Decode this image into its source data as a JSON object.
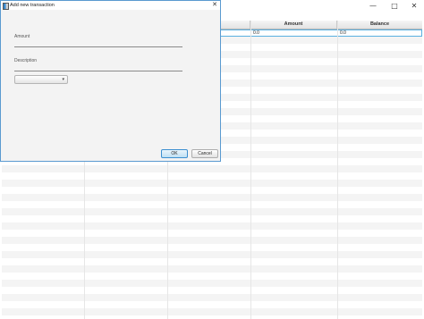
{
  "main_window": {
    "controls": {
      "minimize": "—",
      "maximize": "□",
      "close": "✕"
    },
    "table": {
      "columns": [
        "",
        "",
        "",
        "Amount",
        "Balance"
      ],
      "first_row": [
        "",
        "",
        "",
        "0.0",
        "0.0"
      ]
    }
  },
  "dialog": {
    "title": "Add new transaction",
    "close_glyph": "✕",
    "amount_label": "Amount",
    "description_label": "Description",
    "combo_value": "",
    "combo_arrow": "▾",
    "ok_label": "OK",
    "cancel_label": "Cancel"
  },
  "colors": {
    "accent": "#3c8fd0",
    "row_stripe": "#f4f4f4",
    "dialog_bg": "#f3f3f3"
  }
}
